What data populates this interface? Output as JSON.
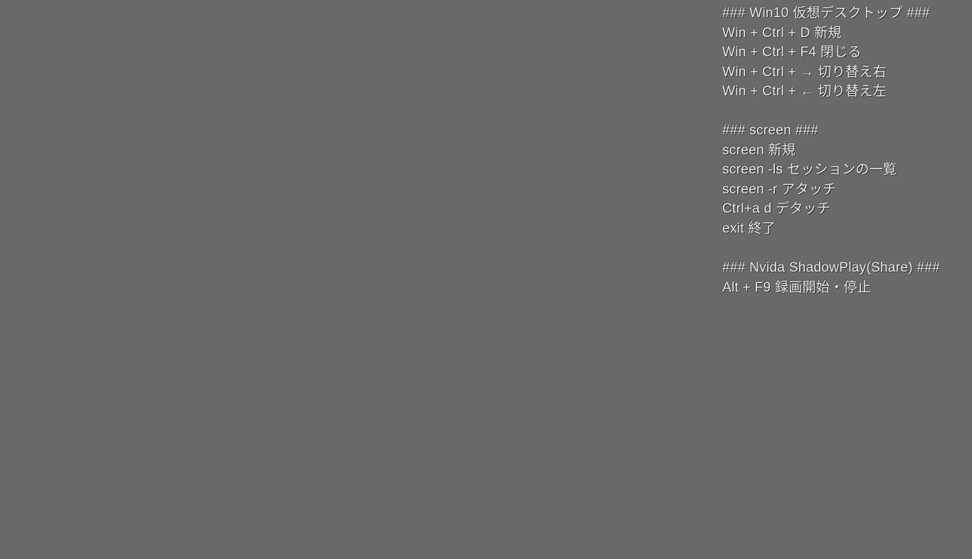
{
  "sections": [
    {
      "heading": "### Win10 仮想デスクトップ ###",
      "lines": [
        "Win + Ctrl + D 新規",
        "Win + Ctrl + F4 閉じる",
        "Win + Ctrl + → 切り替え右",
        "Win + Ctrl + ← 切り替え左"
      ]
    },
    {
      "heading": "### screen ###",
      "lines": [
        "screen 新規",
        "screen -ls セッションの一覧",
        "screen -r アタッチ",
        "Ctrl+a d デタッチ",
        "exit 終了"
      ]
    },
    {
      "heading": "### Nvida ShadowPlay(Share) ###",
      "lines": [
        "Alt + F9 録画開始・停止"
      ]
    }
  ]
}
